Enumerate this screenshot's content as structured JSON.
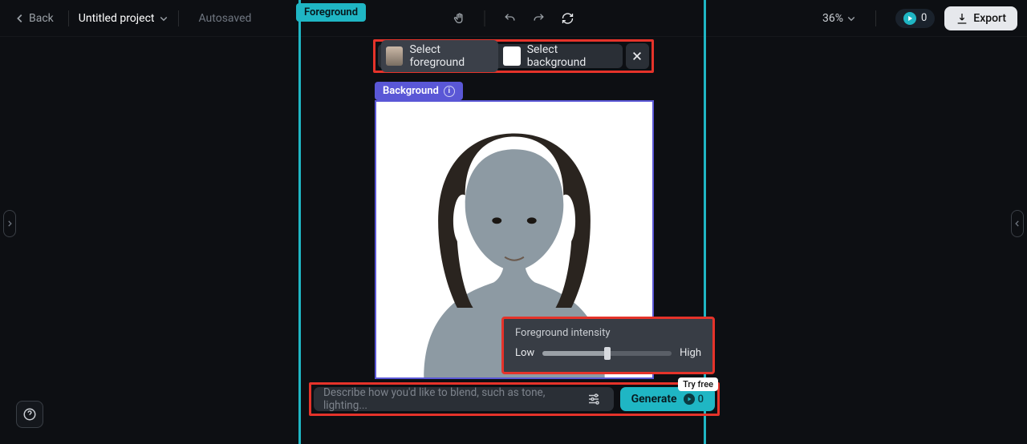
{
  "topbar": {
    "back_label": "Back",
    "project_name": "Untitled project",
    "autosaved_label": "Autosaved",
    "zoom_level": "36%",
    "credit_count": "0",
    "export_label": "Export"
  },
  "mode_pill": "Foreground",
  "selection": {
    "foreground_label": "Select foreground",
    "background_label": "Select background"
  },
  "background_pill": "Background",
  "intensity": {
    "title": "Foreground intensity",
    "low_label": "Low",
    "high_label": "High",
    "value_pct": 50
  },
  "prompt": {
    "placeholder": "Describe how you'd like to blend, such as tone, lighting...",
    "generate_label": "Generate",
    "generate_cost": "0",
    "try_free_label": "Try free"
  }
}
